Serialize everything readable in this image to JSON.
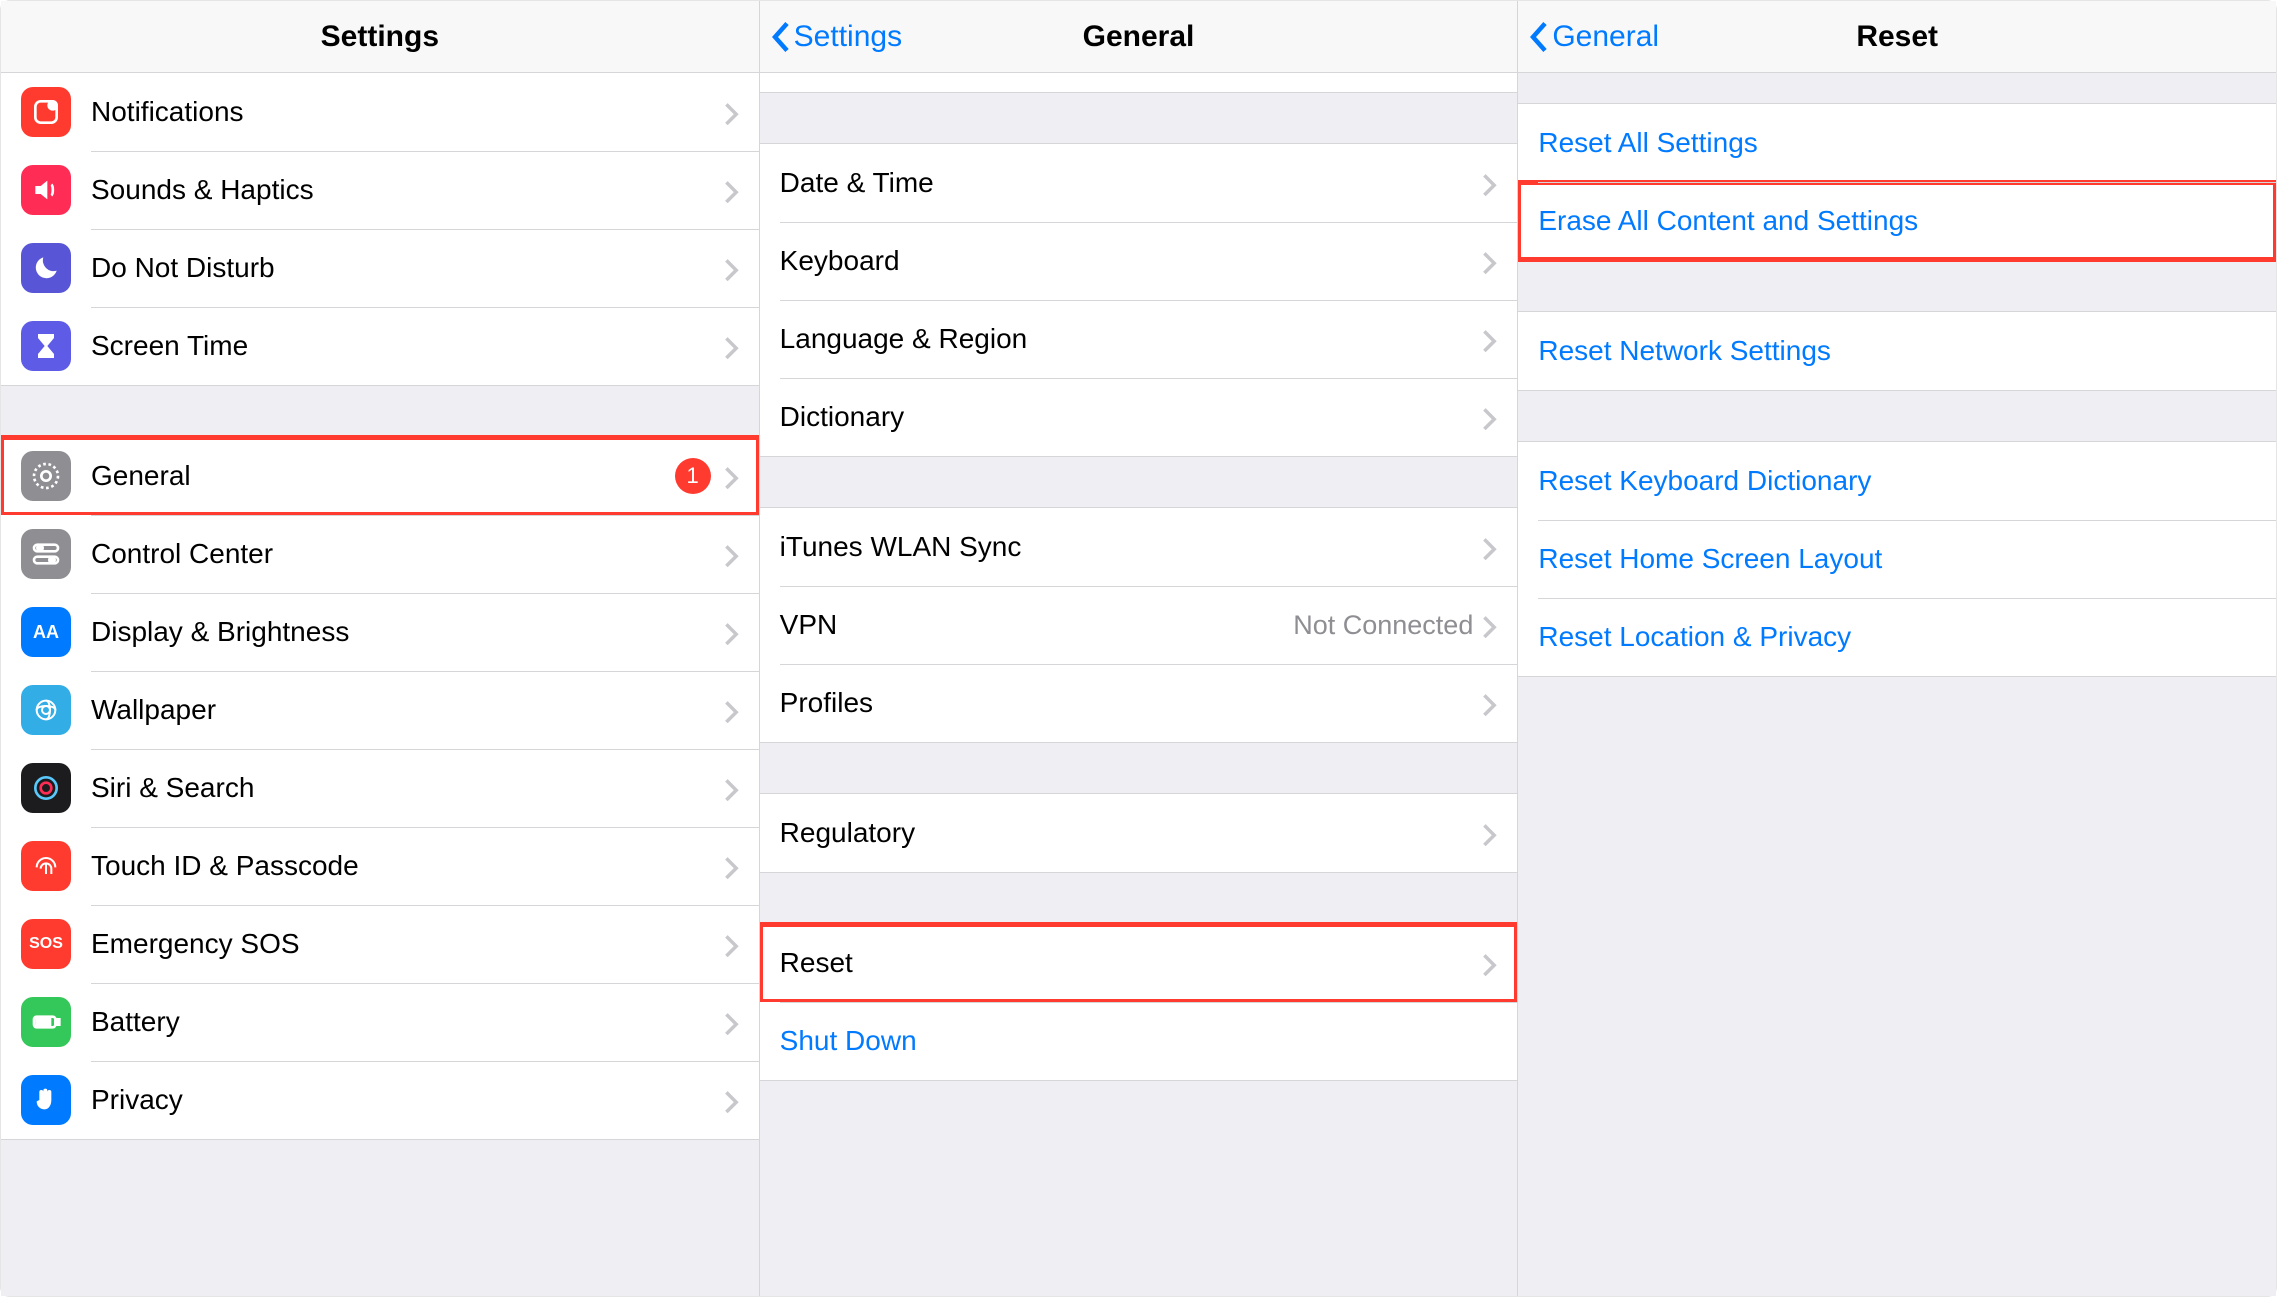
{
  "panel1": {
    "title": "Settings",
    "group1": [
      {
        "label": "Notifications",
        "icon": "notifications-icon",
        "color": "ic-red"
      },
      {
        "label": "Sounds & Haptics",
        "icon": "sounds-icon",
        "color": "ic-pink"
      },
      {
        "label": "Do Not Disturb",
        "icon": "moon-icon",
        "color": "ic-purple"
      },
      {
        "label": "Screen Time",
        "icon": "hourglass-icon",
        "color": "ic-indigo"
      }
    ],
    "group2": [
      {
        "label": "General",
        "icon": "gear-icon",
        "color": "ic-gray",
        "badge": "1",
        "highlight": true
      },
      {
        "label": "Control Center",
        "icon": "toggles-icon",
        "color": "ic-gray"
      },
      {
        "label": "Display & Brightness",
        "icon": "display-icon",
        "color": "ic-blue"
      },
      {
        "label": "Wallpaper",
        "icon": "wallpaper-icon",
        "color": "ic-teal"
      },
      {
        "label": "Siri & Search",
        "icon": "siri-icon",
        "color": "ic-black"
      },
      {
        "label": "Touch ID & Passcode",
        "icon": "fingerprint-icon",
        "color": "ic-red"
      },
      {
        "label": "Emergency SOS",
        "icon": "sos-icon",
        "color": "ic-red",
        "glyph": "SOS"
      },
      {
        "label": "Battery",
        "icon": "battery-icon",
        "color": "ic-green"
      },
      {
        "label": "Privacy",
        "icon": "hand-icon",
        "color": "ic-blue"
      }
    ]
  },
  "panel2": {
    "back": "Settings",
    "title": "General",
    "group1": [
      {
        "label": "Date & Time"
      },
      {
        "label": "Keyboard"
      },
      {
        "label": "Language & Region"
      },
      {
        "label": "Dictionary"
      }
    ],
    "group2": [
      {
        "label": "iTunes WLAN Sync"
      },
      {
        "label": "VPN",
        "value": "Not Connected"
      },
      {
        "label": "Profiles"
      }
    ],
    "group3": [
      {
        "label": "Regulatory"
      }
    ],
    "group4": [
      {
        "label": "Reset",
        "highlight": true
      },
      {
        "label": "Shut Down",
        "link": true,
        "nochevron": true
      }
    ]
  },
  "panel3": {
    "back": "General",
    "title": "Reset",
    "group1": [
      {
        "label": "Reset All Settings",
        "link": true
      },
      {
        "label": "Erase All Content and Settings",
        "link": true,
        "highlight": true
      }
    ],
    "group2": [
      {
        "label": "Reset Network Settings",
        "link": true
      }
    ],
    "group3": [
      {
        "label": "Reset Keyboard Dictionary",
        "link": true
      },
      {
        "label": "Reset Home Screen Layout",
        "link": true
      },
      {
        "label": "Reset Location & Privacy",
        "link": true
      }
    ]
  }
}
